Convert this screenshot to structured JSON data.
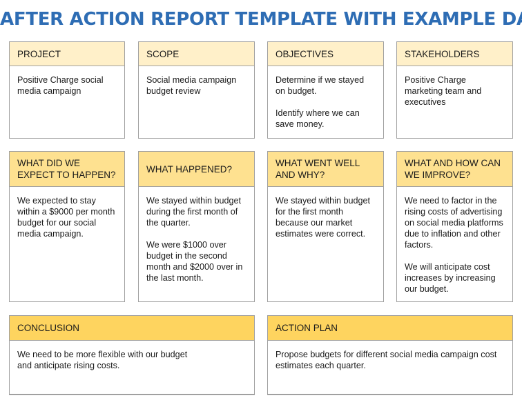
{
  "title": "AFTER ACTION REPORT TEMPLATE WITH EXAMPLE DATA",
  "colors": {
    "title": "#2e6db4",
    "row1_header": "#fff0c9",
    "row2_header": "#fee190",
    "row3_header": "#fed45f",
    "border": "#a0a0a0"
  },
  "row1": [
    {
      "heading": "PROJECT",
      "paragraphs": [
        "Positive Charge social media  campaign"
      ]
    },
    {
      "heading": "SCOPE",
      "paragraphs": [
        "Social media campaign budget review"
      ]
    },
    {
      "heading": "OBJECTIVES",
      "paragraphs": [
        "Determine if we stayed on budget.",
        "Identify where we can save money."
      ]
    },
    {
      "heading": "STAKEHOLDERS",
      "paragraphs": [
        "Positive Charge marketing team and executives"
      ]
    }
  ],
  "row2": [
    {
      "heading": "WHAT DID WE EXPECT TO HAPPEN?",
      "paragraphs": [
        "We expected to stay within a $9000 per month budget for our social media campaign."
      ]
    },
    {
      "heading": "WHAT HAPPENED?",
      "paragraphs": [
        "We stayed within budget during the first month of the quarter.",
        "We were $1000 over budget in the second month and $2000 over in the last month."
      ]
    },
    {
      "heading": "WHAT WENT WELL AND WHY?",
      "paragraphs": [
        "We stayed within budget for the first month because our market estimates were correct."
      ]
    },
    {
      "heading": "WHAT AND HOW CAN WE IMPROVE?",
      "paragraphs": [
        "We need to factor in the rising costs of advertising on social media platforms due to inflation and other factors.",
        "We will anticipate cost increases by increasing our budget."
      ]
    }
  ],
  "row3": [
    {
      "heading": "CONCLUSION",
      "paragraphs": [
        "We need to be more flexible with our budget",
        "and anticipate rising costs."
      ]
    },
    {
      "heading": "ACTION PLAN",
      "paragraphs": [
        "Propose budgets for different social media campaign cost estimates each quarter."
      ]
    }
  ]
}
